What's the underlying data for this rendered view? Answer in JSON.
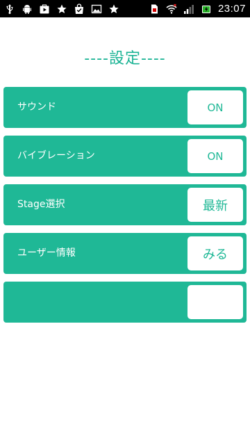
{
  "status_bar": {
    "time": "23:07",
    "left_icons": [
      "usb-icon",
      "android-icon",
      "play-store-icon",
      "star-icon",
      "shopping-bag-icon",
      "image-icon",
      "star-icon"
    ],
    "right_icons": [
      "sim-icon",
      "wifi-icon",
      "signal-icon",
      "battery-icon"
    ]
  },
  "page": {
    "title": "----設定----"
  },
  "settings": [
    {
      "label": "サウンド",
      "value": "ON"
    },
    {
      "label": "バイブレーション",
      "value": "ON"
    },
    {
      "label": "Stage選択",
      "value": "最新"
    },
    {
      "label": "ユーザー情報",
      "value": "みる"
    },
    {
      "label": "",
      "value": ""
    }
  ],
  "colors": {
    "accent": "#1fb896",
    "title": "#1ab394",
    "status_bar": "#000000"
  }
}
